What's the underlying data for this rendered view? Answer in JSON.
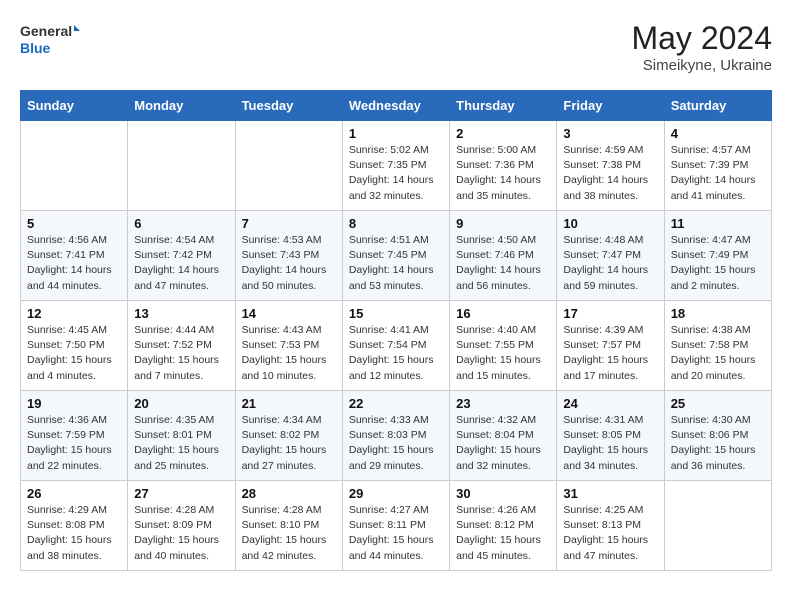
{
  "header": {
    "logo_general": "General",
    "logo_blue": "Blue",
    "month_title": "May 2024",
    "subtitle": "Simeikyne, Ukraine"
  },
  "days_of_week": [
    "Sunday",
    "Monday",
    "Tuesday",
    "Wednesday",
    "Thursday",
    "Friday",
    "Saturday"
  ],
  "weeks": [
    [
      {
        "day": "",
        "info": ""
      },
      {
        "day": "",
        "info": ""
      },
      {
        "day": "",
        "info": ""
      },
      {
        "day": "1",
        "info": "Sunrise: 5:02 AM\nSunset: 7:35 PM\nDaylight: 14 hours\nand 32 minutes."
      },
      {
        "day": "2",
        "info": "Sunrise: 5:00 AM\nSunset: 7:36 PM\nDaylight: 14 hours\nand 35 minutes."
      },
      {
        "day": "3",
        "info": "Sunrise: 4:59 AM\nSunset: 7:38 PM\nDaylight: 14 hours\nand 38 minutes."
      },
      {
        "day": "4",
        "info": "Sunrise: 4:57 AM\nSunset: 7:39 PM\nDaylight: 14 hours\nand 41 minutes."
      }
    ],
    [
      {
        "day": "5",
        "info": "Sunrise: 4:56 AM\nSunset: 7:41 PM\nDaylight: 14 hours\nand 44 minutes."
      },
      {
        "day": "6",
        "info": "Sunrise: 4:54 AM\nSunset: 7:42 PM\nDaylight: 14 hours\nand 47 minutes."
      },
      {
        "day": "7",
        "info": "Sunrise: 4:53 AM\nSunset: 7:43 PM\nDaylight: 14 hours\nand 50 minutes."
      },
      {
        "day": "8",
        "info": "Sunrise: 4:51 AM\nSunset: 7:45 PM\nDaylight: 14 hours\nand 53 minutes."
      },
      {
        "day": "9",
        "info": "Sunrise: 4:50 AM\nSunset: 7:46 PM\nDaylight: 14 hours\nand 56 minutes."
      },
      {
        "day": "10",
        "info": "Sunrise: 4:48 AM\nSunset: 7:47 PM\nDaylight: 14 hours\nand 59 minutes."
      },
      {
        "day": "11",
        "info": "Sunrise: 4:47 AM\nSunset: 7:49 PM\nDaylight: 15 hours\nand 2 minutes."
      }
    ],
    [
      {
        "day": "12",
        "info": "Sunrise: 4:45 AM\nSunset: 7:50 PM\nDaylight: 15 hours\nand 4 minutes."
      },
      {
        "day": "13",
        "info": "Sunrise: 4:44 AM\nSunset: 7:52 PM\nDaylight: 15 hours\nand 7 minutes."
      },
      {
        "day": "14",
        "info": "Sunrise: 4:43 AM\nSunset: 7:53 PM\nDaylight: 15 hours\nand 10 minutes."
      },
      {
        "day": "15",
        "info": "Sunrise: 4:41 AM\nSunset: 7:54 PM\nDaylight: 15 hours\nand 12 minutes."
      },
      {
        "day": "16",
        "info": "Sunrise: 4:40 AM\nSunset: 7:55 PM\nDaylight: 15 hours\nand 15 minutes."
      },
      {
        "day": "17",
        "info": "Sunrise: 4:39 AM\nSunset: 7:57 PM\nDaylight: 15 hours\nand 17 minutes."
      },
      {
        "day": "18",
        "info": "Sunrise: 4:38 AM\nSunset: 7:58 PM\nDaylight: 15 hours\nand 20 minutes."
      }
    ],
    [
      {
        "day": "19",
        "info": "Sunrise: 4:36 AM\nSunset: 7:59 PM\nDaylight: 15 hours\nand 22 minutes."
      },
      {
        "day": "20",
        "info": "Sunrise: 4:35 AM\nSunset: 8:01 PM\nDaylight: 15 hours\nand 25 minutes."
      },
      {
        "day": "21",
        "info": "Sunrise: 4:34 AM\nSunset: 8:02 PM\nDaylight: 15 hours\nand 27 minutes."
      },
      {
        "day": "22",
        "info": "Sunrise: 4:33 AM\nSunset: 8:03 PM\nDaylight: 15 hours\nand 29 minutes."
      },
      {
        "day": "23",
        "info": "Sunrise: 4:32 AM\nSunset: 8:04 PM\nDaylight: 15 hours\nand 32 minutes."
      },
      {
        "day": "24",
        "info": "Sunrise: 4:31 AM\nSunset: 8:05 PM\nDaylight: 15 hours\nand 34 minutes."
      },
      {
        "day": "25",
        "info": "Sunrise: 4:30 AM\nSunset: 8:06 PM\nDaylight: 15 hours\nand 36 minutes."
      }
    ],
    [
      {
        "day": "26",
        "info": "Sunrise: 4:29 AM\nSunset: 8:08 PM\nDaylight: 15 hours\nand 38 minutes."
      },
      {
        "day": "27",
        "info": "Sunrise: 4:28 AM\nSunset: 8:09 PM\nDaylight: 15 hours\nand 40 minutes."
      },
      {
        "day": "28",
        "info": "Sunrise: 4:28 AM\nSunset: 8:10 PM\nDaylight: 15 hours\nand 42 minutes."
      },
      {
        "day": "29",
        "info": "Sunrise: 4:27 AM\nSunset: 8:11 PM\nDaylight: 15 hours\nand 44 minutes."
      },
      {
        "day": "30",
        "info": "Sunrise: 4:26 AM\nSunset: 8:12 PM\nDaylight: 15 hours\nand 45 minutes."
      },
      {
        "day": "31",
        "info": "Sunrise: 4:25 AM\nSunset: 8:13 PM\nDaylight: 15 hours\nand 47 minutes."
      },
      {
        "day": "",
        "info": ""
      }
    ]
  ]
}
